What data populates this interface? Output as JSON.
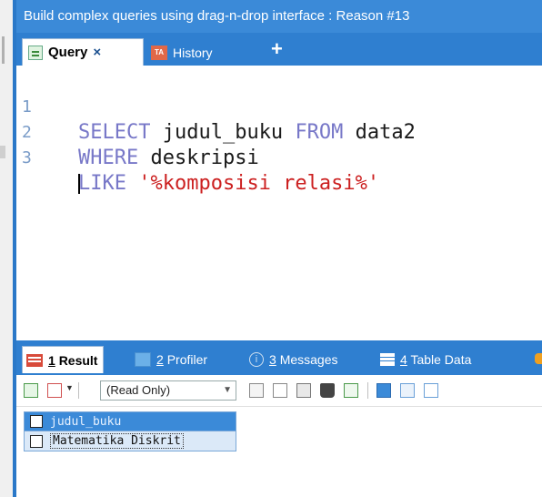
{
  "window": {
    "banner_text": "Build complex queries using drag-n-drop interface : Reason #13"
  },
  "editor_tabs": [
    {
      "label": "Query",
      "icon": "query-icon",
      "active": true,
      "close": "×"
    },
    {
      "label": "History",
      "icon": "history-icon",
      "active": false
    }
  ],
  "add_tab_label": "+",
  "editor": {
    "lines": [
      {
        "num": "1",
        "tokens": [
          "SELECT",
          " judul_buku ",
          "FROM",
          " data2"
        ]
      },
      {
        "num": "2",
        "tokens": [
          "WHERE",
          " deskripsi"
        ]
      },
      {
        "num": "3",
        "tokens": [
          "LIKE",
          " ",
          "'%komposisi relasi%'"
        ]
      }
    ]
  },
  "result_tabs": [
    {
      "num": "1",
      "label": "Result",
      "active": true
    },
    {
      "num": "2",
      "label": "Profiler",
      "active": false
    },
    {
      "num": "3",
      "label": "Messages",
      "active": false
    },
    {
      "num": "4",
      "label": "Table Data",
      "active": false
    }
  ],
  "toolbar": {
    "mode_select": "(Read Only)"
  },
  "grid": {
    "columns": [
      "judul_buku"
    ],
    "rows": [
      [
        "Matematika Diskrit"
      ]
    ]
  },
  "colors": {
    "accent": "#2f7fd0",
    "keyword": "#7878c8",
    "string": "#cc2020",
    "line_number": "#7a9cc8"
  }
}
